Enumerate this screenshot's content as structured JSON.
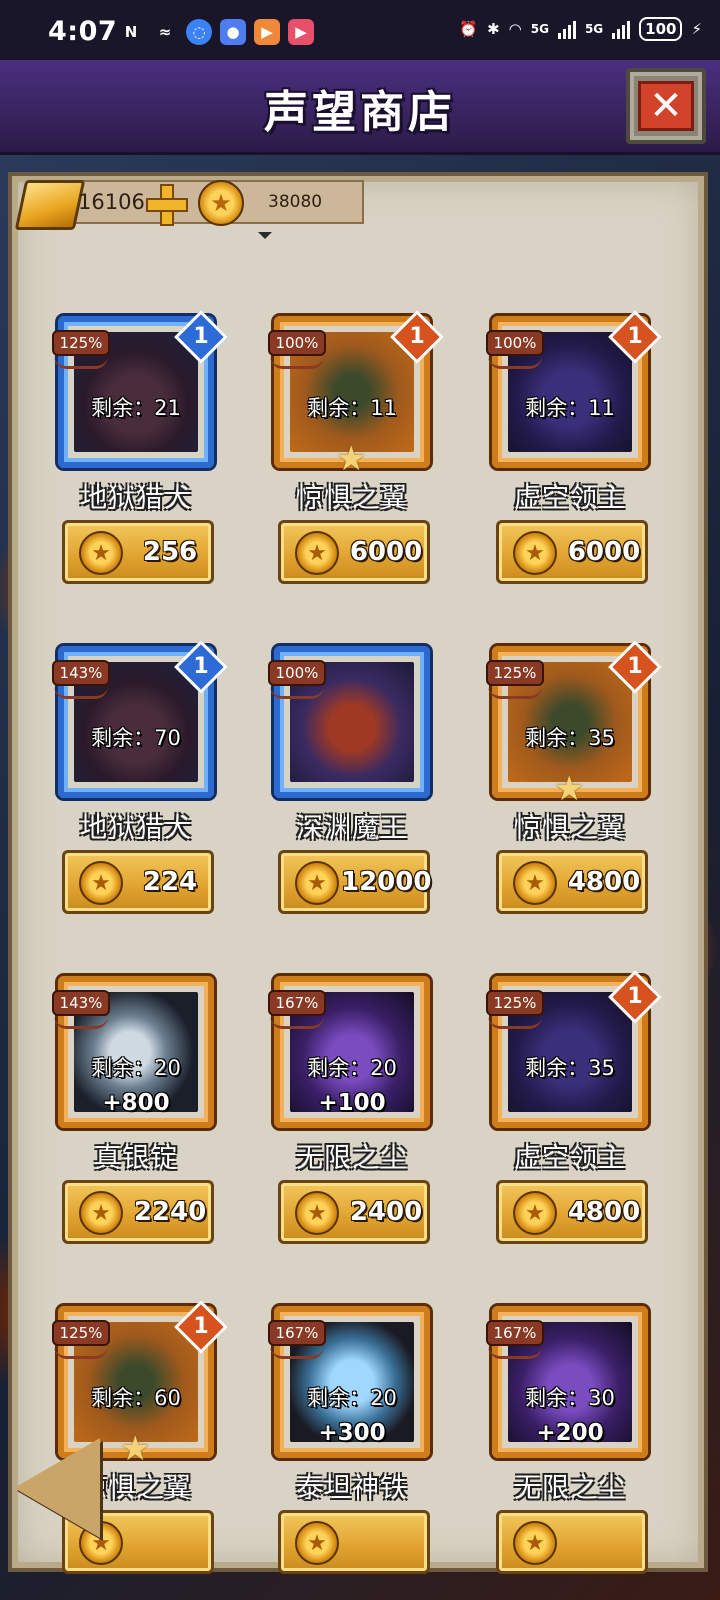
{
  "status_bar": {
    "time": "4:07",
    "battery": "100",
    "network": "5G",
    "icons": [
      "nfc-icon",
      "link-icon",
      "app-icon",
      "app-icon",
      "play-icon",
      "video-icon",
      "alarm-icon",
      "bluetooth-icon",
      "wifi-icon"
    ]
  },
  "header": {
    "title": "声望商店",
    "close_icon": "close-icon"
  },
  "currency": {
    "gold_bars": "16106",
    "coins": "38080"
  },
  "colors": {
    "header": "#362159",
    "parchment": "#d8d3c4",
    "price_button": "#e0a22e",
    "blue_frame": "#2c6ad0",
    "orange_frame": "#cf7d1b"
  },
  "items": [
    {
      "name": "地狱猎犬",
      "bonus": "125%",
      "remaining": "剩余：21",
      "price": "256",
      "gem": "1",
      "frame": "blue",
      "art": "hound"
    },
    {
      "name": "惊惧之翼",
      "bonus": "100%",
      "remaining": "剩余：11",
      "price": "6000",
      "gem": "1",
      "frame": "orange",
      "art": "wing",
      "star": true
    },
    {
      "name": "虚空领主",
      "bonus": "100%",
      "remaining": "剩余：11",
      "price": "6000",
      "gem": "1",
      "frame": "orange",
      "art": "void"
    },
    {
      "name": "地狱猎犬",
      "bonus": "143%",
      "remaining": "剩余：70",
      "price": "224",
      "gem": "1",
      "frame": "blue",
      "art": "hound"
    },
    {
      "name": "深渊魔王",
      "bonus": "100%",
      "remaining": "",
      "price": "12000",
      "gem": "",
      "frame": "blue",
      "art": "abyss"
    },
    {
      "name": "惊惧之翼",
      "bonus": "125%",
      "remaining": "剩余：35",
      "price": "4800",
      "gem": "1",
      "frame": "orange",
      "art": "wing",
      "star": true
    },
    {
      "name": "真银锭",
      "bonus": "143%",
      "remaining": "剩余：20",
      "amount": "+800",
      "price": "2240",
      "gem": "",
      "frame": "orange",
      "art": "ingot"
    },
    {
      "name": "无限之尘",
      "bonus": "167%",
      "remaining": "剩余：20",
      "amount": "+100",
      "price": "2400",
      "gem": "",
      "frame": "orange",
      "art": "dust"
    },
    {
      "name": "虚空领主",
      "bonus": "125%",
      "remaining": "剩余：35",
      "price": "4800",
      "gem": "1",
      "frame": "orange",
      "art": "void"
    },
    {
      "name": "惊惧之翼",
      "bonus": "125%",
      "remaining": "剩余：60",
      "price": "",
      "gem": "1",
      "frame": "orange",
      "art": "wing",
      "star": true
    },
    {
      "name": "泰坦神铁",
      "bonus": "167%",
      "remaining": "剩余：20",
      "amount": "+300",
      "price": "",
      "gem": "",
      "frame": "orange",
      "art": "iron"
    },
    {
      "name": "无限之尘",
      "bonus": "167%",
      "remaining": "剩余：30",
      "amount": "+200",
      "price": "",
      "gem": "",
      "frame": "orange",
      "art": "dust"
    }
  ]
}
